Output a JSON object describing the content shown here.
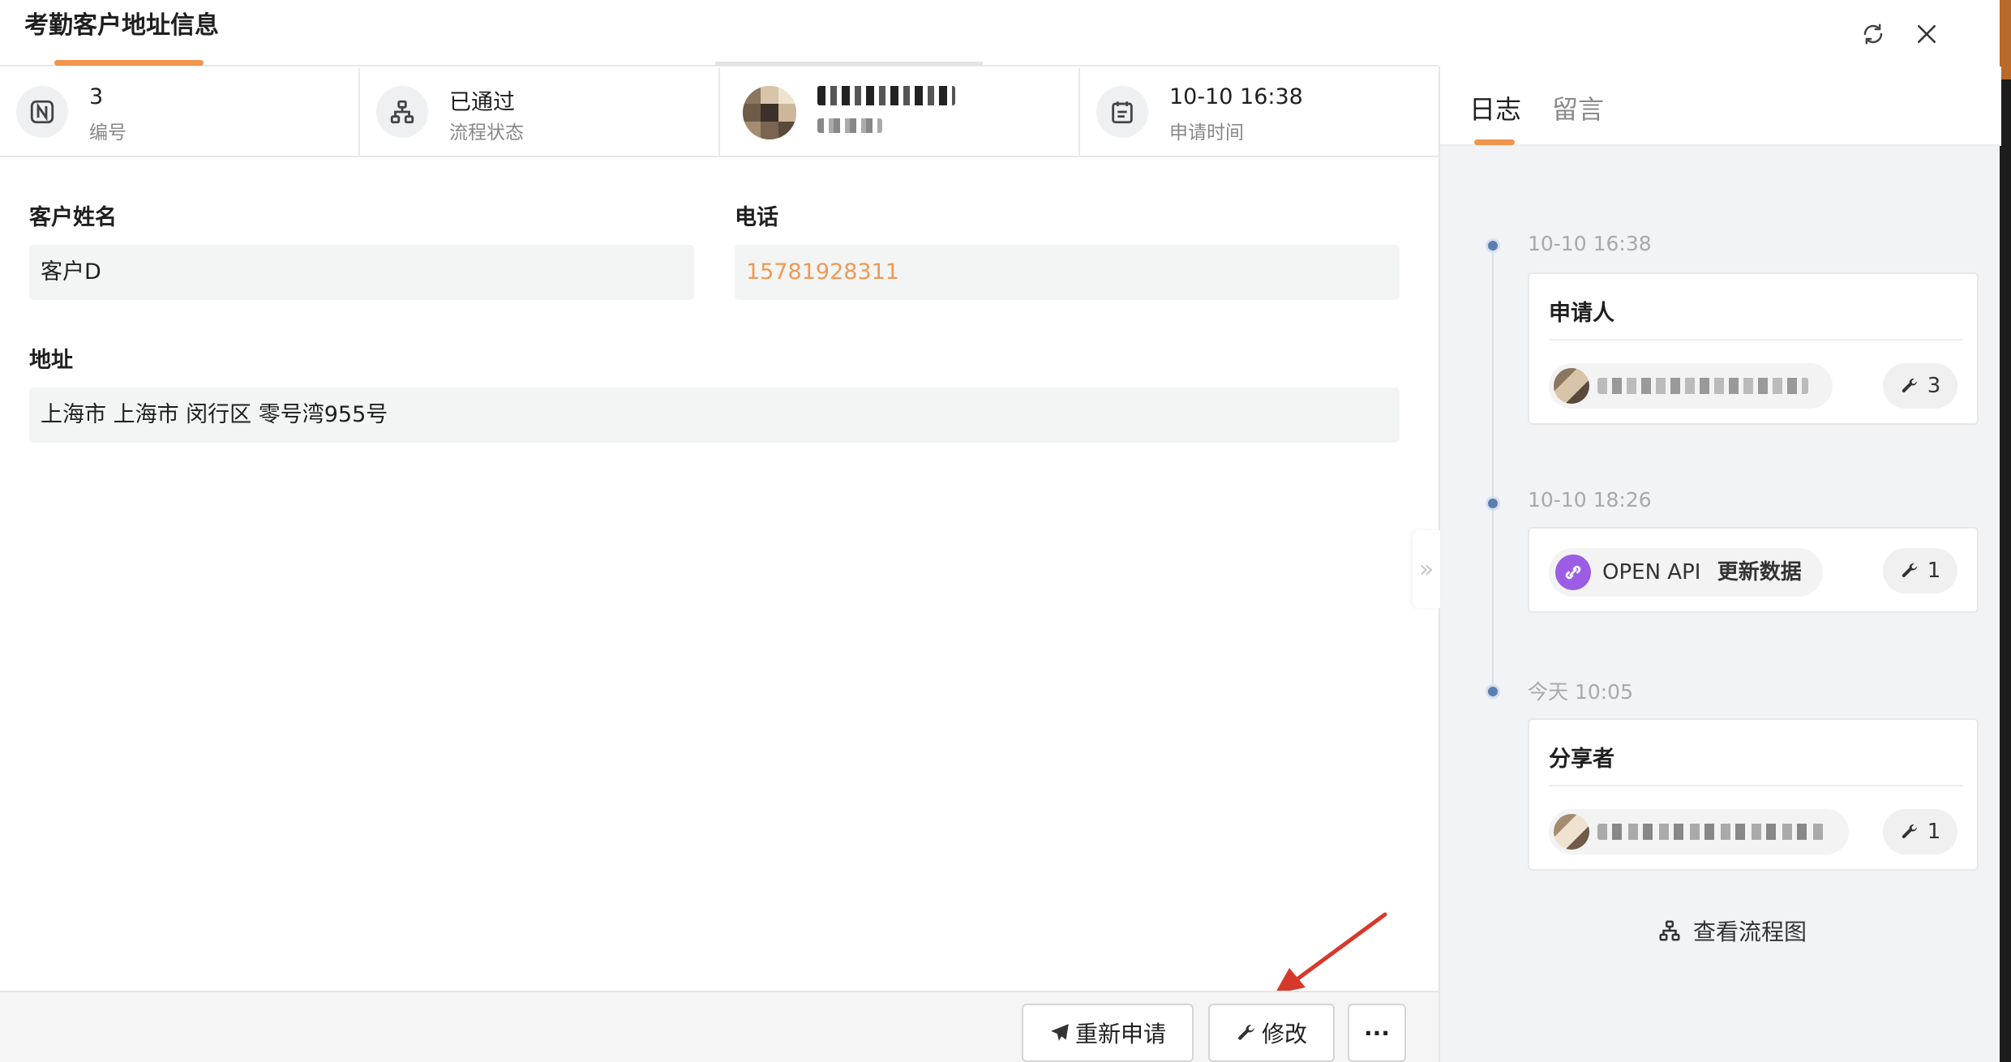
{
  "header": {
    "title": "考勤客户地址信息"
  },
  "info": {
    "number": {
      "value": "3",
      "label": "编号",
      "icon": "n-letter-icon"
    },
    "status": {
      "value": "已通过",
      "label": "流程状态",
      "icon": "flow-icon"
    },
    "applicant": {
      "name_redacted": true
    },
    "time": {
      "value": "10-10 16:38",
      "label": "申请时间",
      "icon": "calendar-icon"
    }
  },
  "form": {
    "customer_name_label": "客户姓名",
    "customer_name_value": "客户D",
    "phone_label": "电话",
    "phone_value": "15781928311",
    "address_label": "地址",
    "address_value": "上海市 上海市 闵行区 零号湾955号"
  },
  "footer": {
    "reapply_label": "重新申请",
    "edit_label": "修改",
    "more_label": "···"
  },
  "sidebar": {
    "tab_log": "日志",
    "tab_comment": "留言",
    "entries": [
      {
        "time": "10-10 16:38",
        "title": "申请人",
        "count": "3"
      },
      {
        "time": "10-10 18:26",
        "api_label": "OPEN API",
        "api_action": "更新数据",
        "count": "1"
      },
      {
        "time": "今天 10:05",
        "title": "分享者",
        "count": "1"
      }
    ],
    "flow_link": "查看流程图",
    "collapse_glyph": "»"
  },
  "colors": {
    "accent": "#f0954b",
    "phone": "#ee9954",
    "timeline_dot": "#5b7fb0",
    "api_icon": "#9b5de5",
    "annotation_arrow": "#d6392b"
  }
}
